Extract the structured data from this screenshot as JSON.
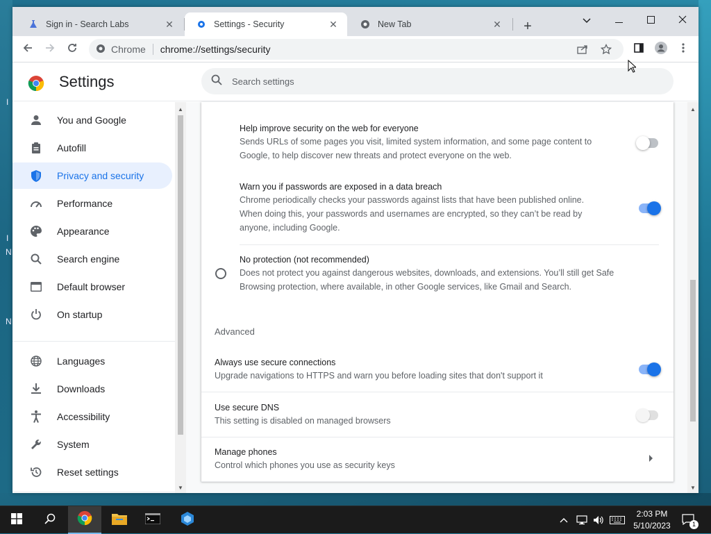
{
  "desktop": {
    "edge_glyphs": [
      "I",
      "N",
      "I",
      "N"
    ]
  },
  "tabs": [
    {
      "title": "Sign in - Search Labs",
      "icon": "flask-icon"
    },
    {
      "title": "Settings - Security",
      "icon": "gear-icon"
    },
    {
      "title": "New Tab",
      "icon": "chrome-icon"
    }
  ],
  "toolbar": {
    "omnibox_chip": "Chrome",
    "url": "chrome://settings/security"
  },
  "header": {
    "title": "Settings",
    "search_placeholder": "Search settings"
  },
  "sidebar": {
    "items": [
      {
        "label": "You and Google",
        "icon": "person-icon"
      },
      {
        "label": "Autofill",
        "icon": "clipboard-icon"
      },
      {
        "label": "Privacy and security",
        "icon": "shield-icon",
        "active": true
      },
      {
        "label": "Performance",
        "icon": "speedometer-icon"
      },
      {
        "label": "Appearance",
        "icon": "palette-icon"
      },
      {
        "label": "Search engine",
        "icon": "search-icon"
      },
      {
        "label": "Default browser",
        "icon": "browser-icon"
      },
      {
        "label": "On startup",
        "icon": "power-icon"
      },
      {
        "label": "Languages",
        "icon": "globe-icon"
      },
      {
        "label": "Downloads",
        "icon": "download-icon"
      },
      {
        "label": "Accessibility",
        "icon": "accessibility-icon"
      },
      {
        "label": "System",
        "icon": "wrench-icon"
      },
      {
        "label": "Reset settings",
        "icon": "history-icon"
      }
    ]
  },
  "main": {
    "help_improve": {
      "title": "Help improve security on the web for everyone",
      "desc1": "Sends URLs of some pages you visit, limited system information, and some page content to",
      "desc2": "Google, to help discover new threats and protect everyone on the web.",
      "enabled": false
    },
    "password_breach": {
      "title": "Warn you if passwords are exposed in a data breach",
      "desc1": "Chrome periodically checks your passwords against lists that have been published online.",
      "desc2": "When doing this, your passwords and usernames are encrypted, so they can’t be read by",
      "desc3": "anyone, including Google.",
      "enabled": true
    },
    "no_protection": {
      "title": "No protection (not recommended)",
      "desc1": "Does not protect you against dangerous websites, downloads, and extensions. You’ll still get Safe",
      "desc2": "Browsing protection, where available, in other Google services, like Gmail and Search.",
      "selected": false
    },
    "advanced_label": "Advanced",
    "secure_connections": {
      "title": "Always use secure connections",
      "desc": "Upgrade navigations to HTTPS and warn you before loading sites that don't support it",
      "enabled": true
    },
    "secure_dns": {
      "title": "Use secure DNS",
      "desc": "This setting is disabled on managed browsers",
      "enabled": false,
      "disabled": true
    },
    "manage_phones": {
      "title": "Manage phones",
      "desc": "Control which phones you use as security keys"
    }
  },
  "taskbar": {
    "apps": [
      "windows-start-icon",
      "search-icon",
      "chrome-icon",
      "file-explorer-icon",
      "terminal-icon",
      "app-icon"
    ],
    "time": "2:03 PM",
    "date": "5/10/2023",
    "notification_count": "1"
  },
  "colors": {
    "accent": "#1a73e8",
    "active_nav_bg": "#e8f0fe",
    "tabstrip": "#dee1e6"
  }
}
